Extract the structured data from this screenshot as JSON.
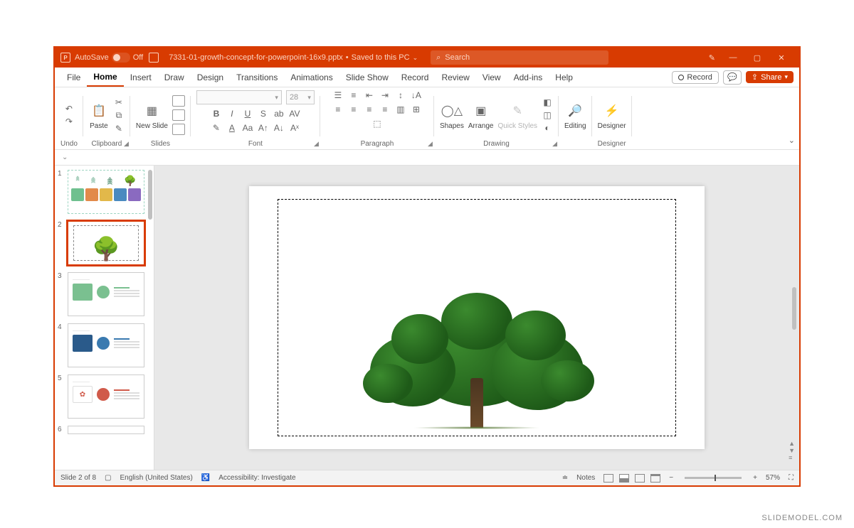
{
  "titlebar": {
    "autosave_label": "AutoSave",
    "autosave_state": "Off",
    "filename": "7331-01-growth-concept-for-powerpoint-16x9.pptx",
    "saved_text": "Saved to this PC",
    "search_placeholder": "Search"
  },
  "menu": {
    "tabs": [
      "File",
      "Home",
      "Insert",
      "Draw",
      "Design",
      "Transitions",
      "Animations",
      "Slide Show",
      "Record",
      "Review",
      "View",
      "Add-ins",
      "Help"
    ],
    "active": "Home",
    "record": "Record",
    "share": "Share"
  },
  "ribbon": {
    "undo": "Undo",
    "clipboard": "Clipboard",
    "paste": "Paste",
    "slides": "Slides",
    "new_slide": "New Slide",
    "font": "Font",
    "font_size": "28",
    "paragraph": "Paragraph",
    "drawing": "Drawing",
    "shapes": "Shapes",
    "arrange": "Arrange",
    "quick_styles": "Quick Styles",
    "editing": "Editing",
    "designer": "Designer"
  },
  "thumbs": {
    "slides": [
      "1",
      "2",
      "3",
      "4",
      "5",
      "6"
    ],
    "active": 2
  },
  "status": {
    "slide_pos": "Slide 2 of 8",
    "language": "English (United States)",
    "accessibility": "Accessibility: Investigate",
    "notes": "Notes",
    "zoom": "57%"
  },
  "watermark": "SLIDEMODEL.COM"
}
